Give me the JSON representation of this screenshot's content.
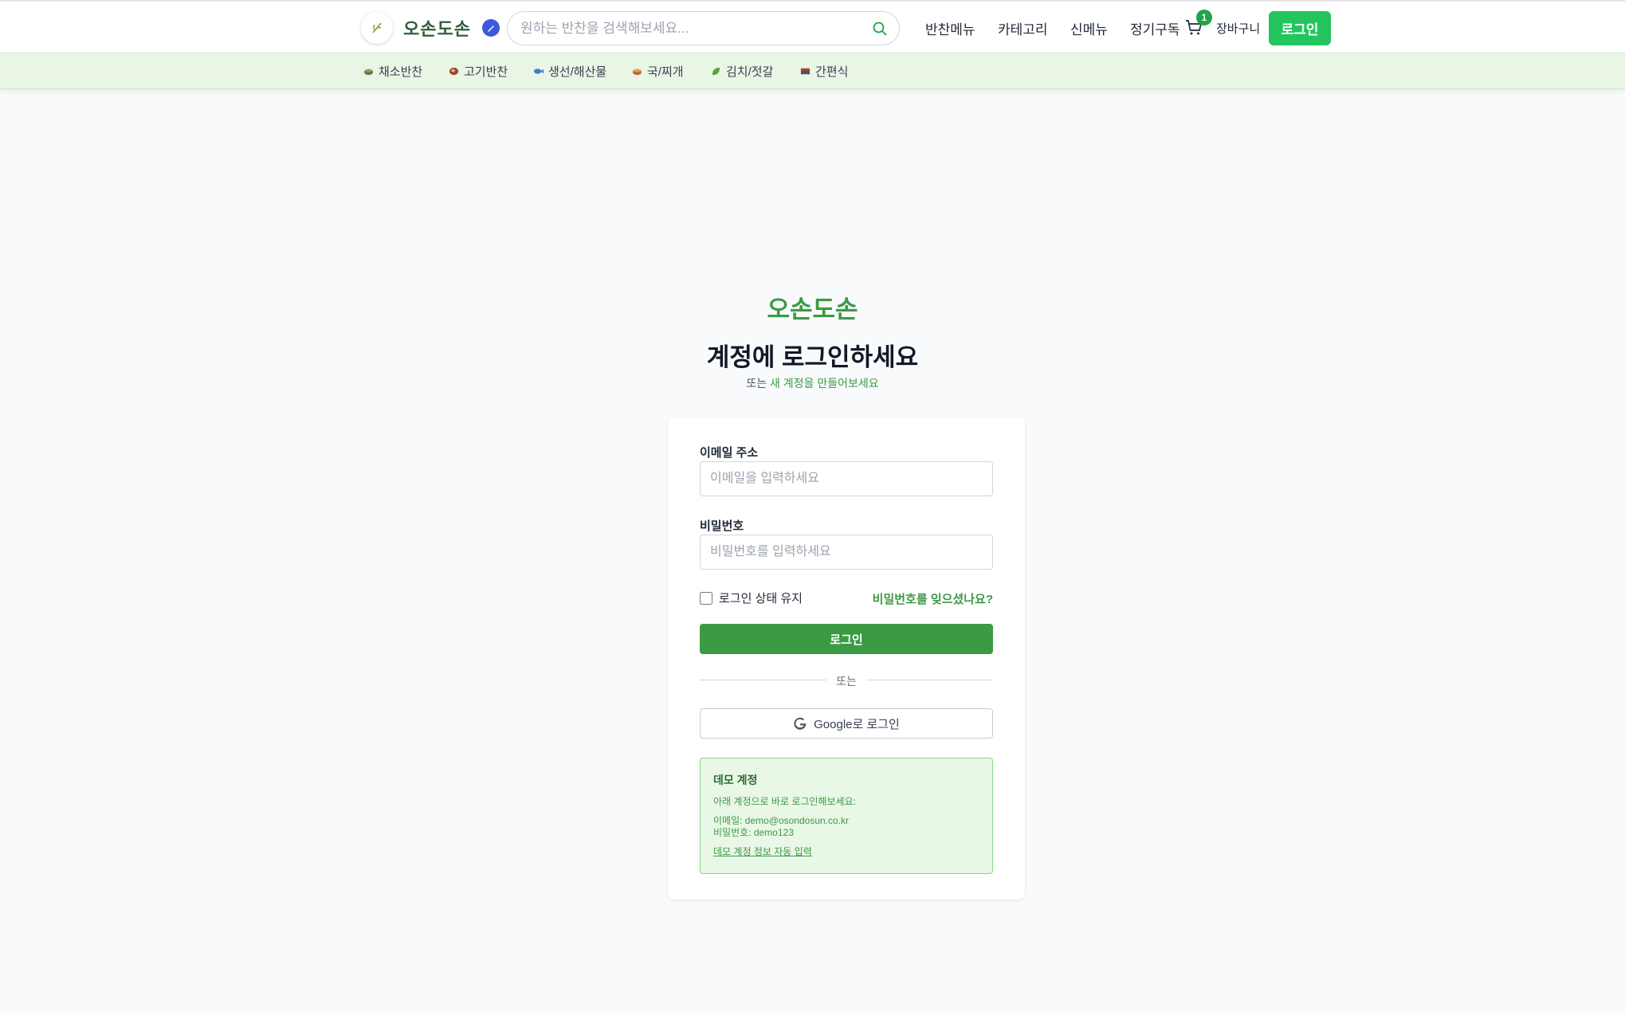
{
  "header": {
    "logo_text": "오손도손",
    "search_placeholder": "원하는 반찬을 검색해보세요...",
    "nav": [
      "반찬메뉴",
      "카테고리",
      "신메뉴",
      "정기구독"
    ],
    "cart_count": "1",
    "cart_label": "장바구니",
    "login_label": "로그인"
  },
  "categories": [
    {
      "label": "채소반찬",
      "icon": "bowl-icon"
    },
    {
      "label": "고기반찬",
      "icon": "meat-icon"
    },
    {
      "label": "생선/해산물",
      "icon": "fish-icon"
    },
    {
      "label": "국/찌개",
      "icon": "soup-icon"
    },
    {
      "label": "김치/젓갈",
      "icon": "leaf-icon"
    },
    {
      "label": "간편식",
      "icon": "box-icon"
    }
  ],
  "main": {
    "brand": "오손도손",
    "heading": "계정에 로그인하세요",
    "sub_prefix": "또는",
    "sub_link": "새 계정을 만들어보세요"
  },
  "form": {
    "email_label": "이메일 주소",
    "email_placeholder": "이메일을 입력하세요",
    "password_label": "비밀번호",
    "password_placeholder": "비밀번호를 입력하세요",
    "remember_label": "로그인 상태 유지",
    "forgot_label": "비밀번호를 잊으셨나요?",
    "submit_label": "로그인",
    "divider_label": "또는",
    "google_label": "Google로 로그인"
  },
  "demo": {
    "title": "데모 계정",
    "description": "아래 계정으로 바로 로그인해보세요:",
    "email_line": "이메일: demo@osondosun.co.kr",
    "password_line": "비밀번호: demo123",
    "autofill_link": "데모 계정 정보 자동 입력"
  },
  "colors": {
    "brand_green": "#3c9a44",
    "login_button": "#22c55e",
    "category_bar": "#e9f5e5",
    "demo_box": "#e9f7e7"
  }
}
